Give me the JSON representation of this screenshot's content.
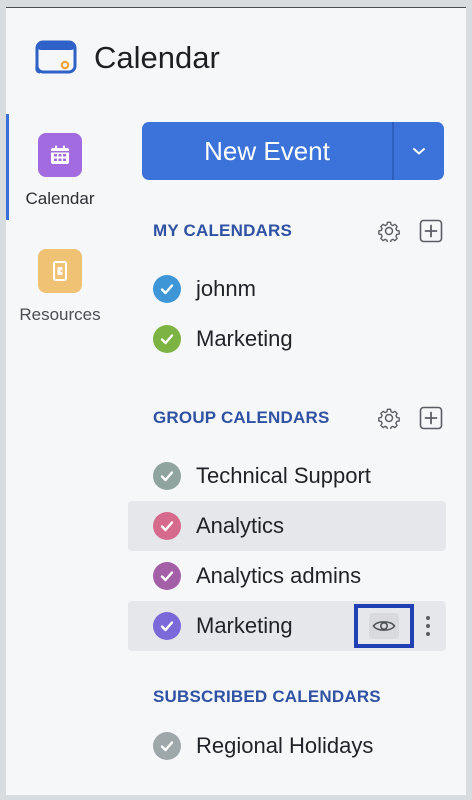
{
  "app": {
    "title": "Calendar"
  },
  "rail": {
    "items": [
      {
        "label": "Calendar",
        "icon": "calendar-icon",
        "color": "#a36be0",
        "active": true
      },
      {
        "label": "Resources",
        "icon": "door-icon",
        "color": "#f0c273",
        "active": false
      }
    ]
  },
  "new_event": {
    "label": "New Event",
    "dropdown_icon": "chevron-down-icon"
  },
  "my_calendars": {
    "title": "MY CALENDARS",
    "items": [
      {
        "name": "johnm",
        "color": "#3e96d6",
        "checked": true
      },
      {
        "name": "Marketing",
        "color": "#7cb342",
        "checked": true
      }
    ]
  },
  "group_calendars": {
    "title": "GROUP CALENDARS",
    "items": [
      {
        "name": "Technical Support",
        "color": "#8fa39f",
        "checked": true
      },
      {
        "name": "Analytics",
        "color": "#d66a8d",
        "checked": true
      },
      {
        "name": "Analytics admins",
        "color": "#a460a6",
        "checked": true
      },
      {
        "name": "Marketing",
        "color": "#7b68d9",
        "checked": true
      }
    ]
  },
  "subscribed_calendars": {
    "title": "SUBSCRIBED CALENDARS",
    "items": [
      {
        "name": "Regional Holidays",
        "color": "#9ea7aa",
        "checked": true
      }
    ]
  },
  "colors": {
    "accent": "#3c73db",
    "section_title": "#2f52a4",
    "highlight_box": "#1f3fb3"
  }
}
